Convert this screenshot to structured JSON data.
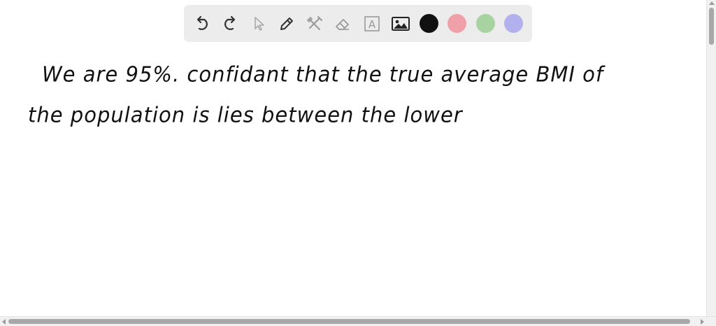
{
  "toolbar": {
    "tools": [
      {
        "name": "undo-icon"
      },
      {
        "name": "redo-icon"
      },
      {
        "name": "select-cursor-icon"
      },
      {
        "name": "pencil-icon"
      },
      {
        "name": "tools-icon"
      },
      {
        "name": "eraser-icon"
      },
      {
        "name": "text-box-icon",
        "glyph": "A"
      },
      {
        "name": "image-icon"
      }
    ],
    "colors": {
      "black": "#111111",
      "red": "#f0a0a8",
      "green": "#a6d3a0",
      "purple": "#b3b0ee"
    }
  },
  "canvas": {
    "handwriting_lines": [
      "We are 95%. confidant that the true average BMI of",
      "the population is lies between the lower"
    ],
    "ink_color": "#111111"
  }
}
